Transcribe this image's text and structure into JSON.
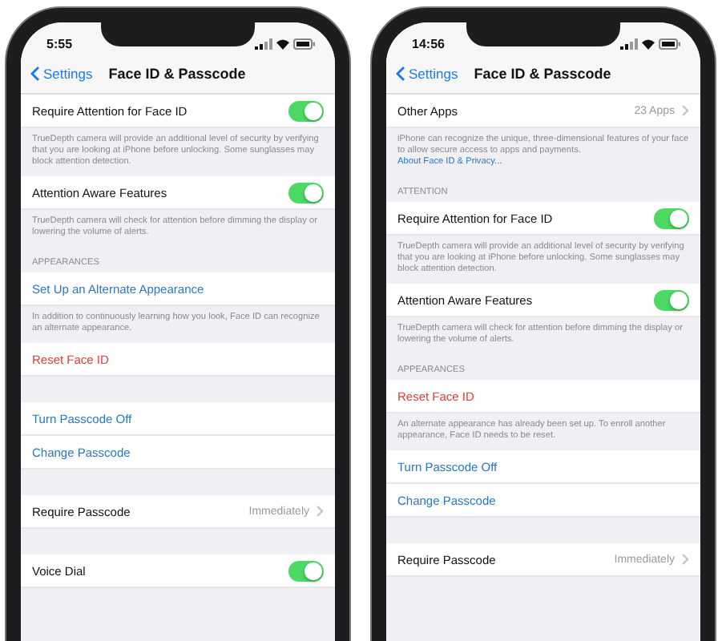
{
  "phones": [
    {
      "status_time": "5:55",
      "back_label": "Settings",
      "title": "Face ID & Passcode",
      "items": [
        {
          "kind": "toggle",
          "label": "Require Attention for Face ID",
          "on": true
        },
        {
          "kind": "footer",
          "text": "TrueDepth camera will provide an additional level of security by verifying that you are looking at iPhone before unlocking. Some sunglasses may block attention detection."
        },
        {
          "kind": "toggle",
          "label": "Attention Aware Features",
          "on": true
        },
        {
          "kind": "footer",
          "text": "TrueDepth camera will check for attention before dimming the display or lowering the volume of alerts."
        },
        {
          "kind": "header",
          "text": "APPEARANCES"
        },
        {
          "kind": "link",
          "label": "Set Up an Alternate Appearance"
        },
        {
          "kind": "footer",
          "text": "In addition to continuously learning how you look, Face ID can recognize an alternate appearance."
        },
        {
          "kind": "destructive",
          "label": "Reset Face ID"
        },
        {
          "kind": "gap"
        },
        {
          "kind": "link",
          "label": "Turn Passcode Off"
        },
        {
          "kind": "link",
          "label": "Change Passcode"
        },
        {
          "kind": "gap"
        },
        {
          "kind": "value",
          "label": "Require Passcode",
          "value": "Immediately"
        },
        {
          "kind": "gap"
        },
        {
          "kind": "toggle",
          "label": "Voice Dial",
          "on": true
        }
      ]
    },
    {
      "status_time": "14:56",
      "back_label": "Settings",
      "title": "Face ID & Passcode",
      "items": [
        {
          "kind": "value",
          "label": "Other Apps",
          "value": "23 Apps"
        },
        {
          "kind": "footer",
          "text": "iPhone can recognize the unique, three-dimensional features of your face to allow secure access to apps and payments.",
          "link": "About Face ID & Privacy..."
        },
        {
          "kind": "header",
          "text": "ATTENTION"
        },
        {
          "kind": "toggle",
          "label": "Require Attention for Face ID",
          "on": true
        },
        {
          "kind": "footer",
          "text": "TrueDepth camera will provide an additional level of security by verifying that you are looking at iPhone before unlocking. Some sunglasses may block attention detection."
        },
        {
          "kind": "toggle",
          "label": "Attention Aware Features",
          "on": true
        },
        {
          "kind": "footer",
          "text": "TrueDepth camera will check for attention before dimming the display or lowering the volume of alerts."
        },
        {
          "kind": "header",
          "text": "APPEARANCES"
        },
        {
          "kind": "destructive",
          "label": "Reset Face ID"
        },
        {
          "kind": "footer",
          "text": "An alternate appearance has already been set up. To enroll another appearance, Face ID needs to be reset."
        },
        {
          "kind": "link",
          "label": "Turn Passcode Off"
        },
        {
          "kind": "link",
          "label": "Change Passcode"
        },
        {
          "kind": "gap"
        },
        {
          "kind": "value",
          "label": "Require Passcode",
          "value": "Immediately"
        }
      ]
    }
  ]
}
